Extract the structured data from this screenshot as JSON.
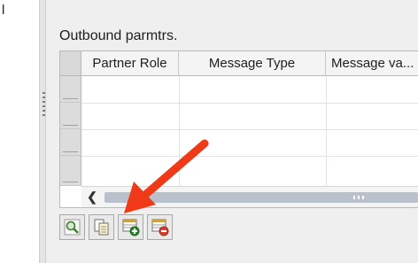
{
  "left_panel": {
    "fragment_char": "l"
  },
  "section": {
    "title": "Outbound parmtrs."
  },
  "table": {
    "columns": [
      {
        "label": "Partner Role"
      },
      {
        "label": "Message Type"
      },
      {
        "label": "Message va..."
      }
    ]
  },
  "toolbar": {
    "buttons": [
      {
        "icon": "details-icon"
      },
      {
        "icon": "copy-icon"
      },
      {
        "icon": "insert-row-icon"
      },
      {
        "icon": "delete-row-icon"
      }
    ]
  },
  "annotation": {
    "arrow_color": "#f03a17"
  }
}
